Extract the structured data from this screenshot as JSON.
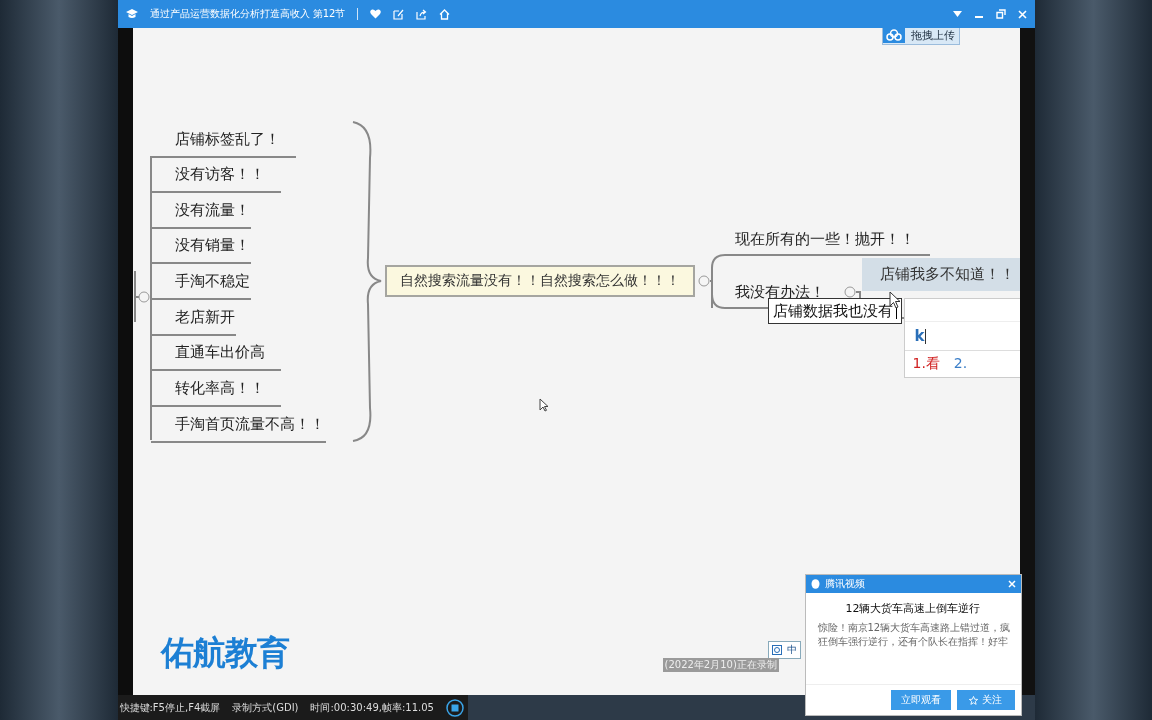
{
  "window": {
    "title": "通过产品运营数据化分析打造高收入 第12节",
    "upload_button": "拖拽上传"
  },
  "mindmap": {
    "central": "自然搜索流量没有！！自然搜索怎么做！！！",
    "left_topics": [
      {
        "text": "店铺标签乱了！"
      },
      {
        "text": "没有访客！！"
      },
      {
        "text": "没有流量！"
      },
      {
        "text": "没有销量！"
      },
      {
        "text": "手淘不稳定"
      },
      {
        "text": "老店新开"
      },
      {
        "text": "直通车出价高"
      },
      {
        "text": "转化率高！！"
      },
      {
        "text": "手淘首页流量不高！！"
      }
    ],
    "right_topics": [
      {
        "text": "现在所有的一些！抛开！！"
      },
      {
        "text": "我没有办法！"
      }
    ],
    "child_topic": "店铺我多不知道！！",
    "editing_text": "店铺数据我也没有"
  },
  "ime": {
    "input": "k",
    "candidates": [
      "1.看",
      "2."
    ]
  },
  "logo": "佑航教育",
  "ime_indicator": "中",
  "recording_status": "(2022年2月10)正在录制",
  "status_bar": [
    "快捷键:F5停止,F4截屏",
    "录制方式(GDI)",
    "时间:00:30:49,帧率:11.05"
  ],
  "popup": {
    "title": "腾讯视频",
    "headline": "12辆大货车高速上倒车逆行",
    "body": "惊险！南京12辆大货车高速路上错过道，疯狂倒车强行逆行，还有个队长在指挥！好牢",
    "buttons": [
      "立即观看",
      "关注"
    ]
  }
}
